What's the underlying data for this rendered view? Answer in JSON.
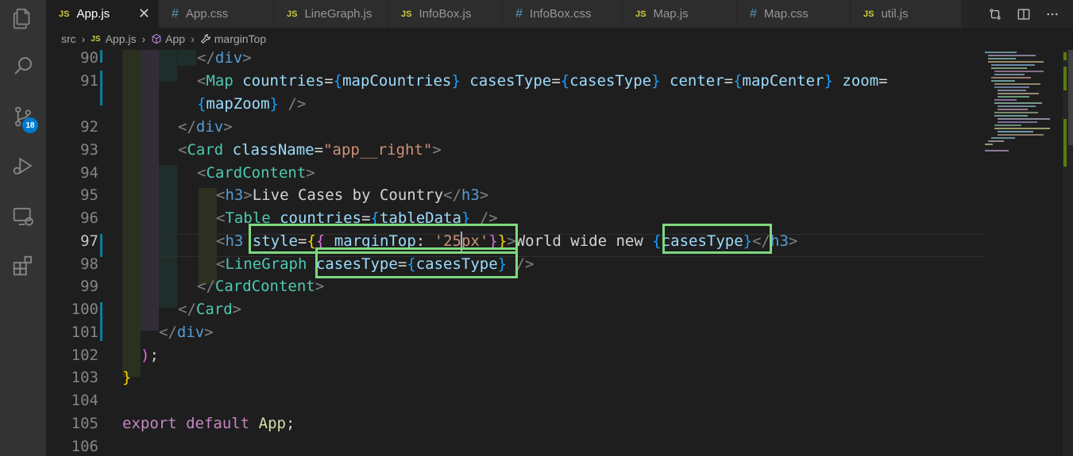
{
  "tabs": [
    {
      "label": "App.js",
      "type": "js",
      "active": true
    },
    {
      "label": "App.css",
      "type": "css"
    },
    {
      "label": "LineGraph.js",
      "type": "js"
    },
    {
      "label": "InfoBox.js",
      "type": "js"
    },
    {
      "label": "InfoBox.css",
      "type": "css"
    },
    {
      "label": "Map.js",
      "type": "js"
    },
    {
      "label": "Map.css",
      "type": "css"
    },
    {
      "label": "util.js",
      "type": "js"
    }
  ],
  "file_icons": {
    "js": "JS",
    "css": "#"
  },
  "tab_close": "✕",
  "activity": {
    "scm_badge": "18"
  },
  "breadcrumb": {
    "folder": "src",
    "file": "App.js",
    "component": "App",
    "symbol": "marginTop",
    "sep": "›"
  },
  "line_numbers": [
    "90",
    "91",
    "",
    "92",
    "93",
    "94",
    "95",
    "96",
    "97",
    "98",
    "99",
    "100",
    "101",
    "102",
    "103",
    "104",
    "105",
    "106"
  ],
  "code": {
    "l90": {
      "lt": "</",
      "tag": "div",
      "gt": ">"
    },
    "l91a": {
      "lt": "<",
      "comp": "Map",
      "a1": "countries",
      "eq": "=",
      "b1o": "{",
      "v1": "mapCountries",
      "b1c": "}",
      "a2": "casesType",
      "v2": "casesType",
      "a3": "center",
      "v3": "mapCenter",
      "a4": "zoom"
    },
    "l91b": {
      "bo": "{",
      "v": "mapZoom",
      "bc": "}",
      "close": "/>"
    },
    "l92": {
      "lt": "</",
      "tag": "div",
      "gt": ">"
    },
    "l93": {
      "lt": "<",
      "comp": "Card",
      "attr": "className",
      "eq": "=",
      "str": "\"app__right\"",
      "gt": ">"
    },
    "l94": {
      "lt": "<",
      "comp": "CardContent",
      "gt": ">"
    },
    "l95": {
      "lt": "<",
      "tag": "h3",
      "gt": ">",
      "text": "Live Cases by Country",
      "clt": "</",
      "ctag": "h3",
      "cgt": ">"
    },
    "l96": {
      "lt": "<",
      "comp": "Table",
      "attr": "countries",
      "eq": "=",
      "bo": "{",
      "v": "tableData",
      "bc": "}",
      "close": "/>"
    },
    "l97": {
      "lt": "<",
      "tag": "h3",
      "attr": "style",
      "eq": "=",
      "b1": "{",
      "b2": "{",
      "prop": "marginTop",
      "colon": ": ",
      "str": "'25px'",
      "b3": "}",
      "b4": "}",
      "gt": ">",
      "text": "World wide new ",
      "bo": "{",
      "v": "casesType",
      "bc": "}",
      "clt": "</",
      "ctag": "h3",
      "cgt": ">"
    },
    "l98": {
      "lt": "<",
      "comp": "LineGraph",
      "attr": "casesType",
      "eq": "=",
      "bo": "{",
      "v": "casesType",
      "bc": "}",
      "close": "/>"
    },
    "l99": {
      "lt": "</",
      "comp": "CardContent",
      "gt": ">"
    },
    "l100": {
      "lt": "</",
      "comp": "Card",
      "gt": ">"
    },
    "l101": {
      "lt": "</",
      "tag": "div",
      "gt": ">"
    },
    "l102": {
      "paren": ")",
      "semi": ";"
    },
    "l103": {
      "brace": "}"
    },
    "l105": {
      "kw1": "export",
      "kw2": "default",
      "name": "App",
      "semi": ";"
    }
  },
  "colors": {
    "accent": "#007acc",
    "highlight_box": "#7fd87f",
    "js_icon": "#cbcb41",
    "css_icon": "#519aba"
  }
}
